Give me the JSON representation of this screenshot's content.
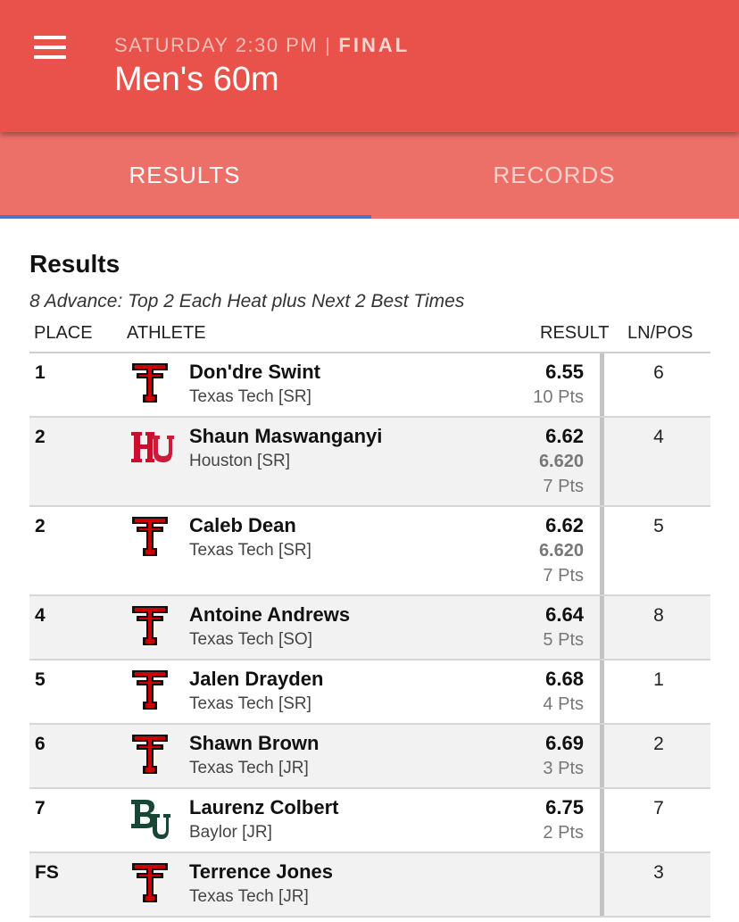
{
  "header": {
    "meta_time": "SATURDAY 2:30 PM",
    "meta_sep": "|",
    "meta_status": "FINAL",
    "title": "Men's 60m"
  },
  "tabs": [
    {
      "label": "RESULTS",
      "active": true
    },
    {
      "label": "RECORDS",
      "active": false
    }
  ],
  "section": {
    "title": "Results",
    "advance": "8 Advance: Top 2 Each Heat plus Next 2 Best Times"
  },
  "columns": {
    "place": "PLACE",
    "athlete": "ATHLETE",
    "result": "RESULT",
    "lnpos": "LN/POS"
  },
  "rows": [
    {
      "place": "1",
      "logo": "texas-tech-logo",
      "name": "Don'dre Swint",
      "team": "Texas Tech [SR]",
      "result": "6.55",
      "precise": "",
      "points": "10 Pts",
      "lane": "6"
    },
    {
      "place": "2",
      "logo": "houston-logo",
      "name": "Shaun Maswanganyi",
      "team": "Houston [SR]",
      "result": "6.62",
      "precise": "6.620",
      "points": "7 Pts",
      "lane": "4"
    },
    {
      "place": "2",
      "logo": "texas-tech-logo",
      "name": "Caleb Dean",
      "team": "Texas Tech [SR]",
      "result": "6.62",
      "precise": "6.620",
      "points": "7 Pts",
      "lane": "5"
    },
    {
      "place": "4",
      "logo": "texas-tech-logo",
      "name": "Antoine Andrews",
      "team": "Texas Tech [SO]",
      "result": "6.64",
      "precise": "",
      "points": "5 Pts",
      "lane": "8"
    },
    {
      "place": "5",
      "logo": "texas-tech-logo",
      "name": "Jalen Drayden",
      "team": "Texas Tech [SR]",
      "result": "6.68",
      "precise": "",
      "points": "4 Pts",
      "lane": "1"
    },
    {
      "place": "6",
      "logo": "texas-tech-logo",
      "name": "Shawn Brown",
      "team": "Texas Tech [JR]",
      "result": "6.69",
      "precise": "",
      "points": "3 Pts",
      "lane": "2"
    },
    {
      "place": "7",
      "logo": "baylor-logo",
      "name": "Laurenz Colbert",
      "team": "Baylor [JR]",
      "result": "6.75",
      "precise": "",
      "points": "2 Pts",
      "lane": "7"
    },
    {
      "place": "FS",
      "logo": "texas-tech-logo",
      "name": "Terrence Jones",
      "team": "Texas Tech [JR]",
      "result": "",
      "precise": "",
      "points": "",
      "lane": "3"
    }
  ],
  "colors": {
    "appbar": "#e8524a",
    "tabbar": "#ec7068",
    "tab_indicator": "#4e74c2",
    "texas_tech_red": "#cc0000",
    "houston_red": "#c8102e",
    "baylor_green": "#154734"
  }
}
